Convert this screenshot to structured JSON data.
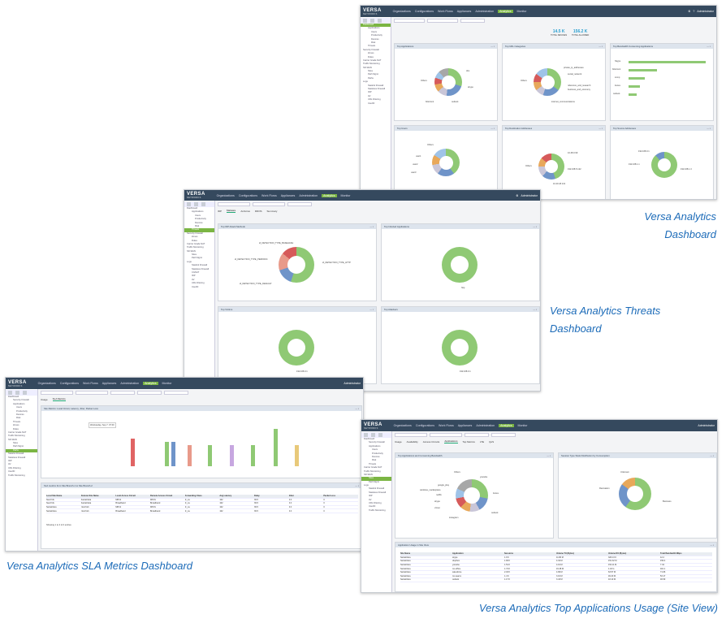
{
  "captions": {
    "dashboard_1": "Versa Analytics",
    "dashboard_2": "Dashboard",
    "threats_1": "Versa Analytics Threats",
    "threats_2": "Dashboard",
    "sla": "Versa Analytics SLA Metrics Dashboard",
    "apps": "Versa Analytics Top Applications Usage (Site View)"
  },
  "brand": {
    "logo": "VERSA",
    "sub": "NETWORKS"
  },
  "nav": [
    "Organizations",
    "Configurations",
    "Work Flows",
    "Appliances",
    "Administration",
    "Analytics",
    "Monitor"
  ],
  "user": "Administrator",
  "sidebar": {
    "items": [
      "Dashboard",
      "Applications",
      "Users",
      "Productivity",
      "Devices",
      "Risk",
      "Threats",
      "Security Firewall",
      "Zones",
      "Rules",
      "Carrier Grade NAT",
      "Traffic Monitoring",
      "SD-WAN",
      "Sites",
      "Path Mgmt",
      "Paths",
      "Logs",
      "Stateful Firewall",
      "Stateless Firewall",
      "CGNAT",
      "IDP",
      "AV",
      "URL Filtering",
      "UserID",
      "Traffic Monitoring",
      "Cgnat"
    ]
  },
  "dashboard": {
    "kpi": [
      {
        "label": "TOTAL DEVICES",
        "value": "14.5 K"
      },
      {
        "label": "TOTAL ALLOWED",
        "value": "156.2 K"
      }
    ],
    "panels": [
      "Top Applications",
      "Top URL Categories",
      "Top Bandwidth Consuming Applications",
      "Top Users",
      "Top Destination Addresses",
      "Top Source Addresses"
    ],
    "labels": {
      "apps": [
        "dns",
        "Others",
        "bittorrent",
        "snmp",
        "skype",
        "icloud",
        "itunes",
        "outlook"
      ],
      "url": [
        "private_ip_addresses",
        "social_network",
        "streaming_media",
        "reference_and_research",
        "business_and_economy",
        "internet_communications",
        "Others"
      ],
      "users": [
        "user1",
        "user2",
        "user3",
        "Others"
      ],
      "dest": [
        "Others",
        "10.48.0.99",
        "192.168.5.122",
        "10.40.18.131"
      ],
      "src": [
        "192.168.0.1",
        "192.168.1.1",
        "192.168.1.3"
      ]
    },
    "bar_labels": [
      "Skype",
      "bittorrent",
      "snmp",
      "itunes",
      "outlook"
    ]
  },
  "threats": {
    "tabs": [
      "IDP",
      "Malware",
      "Antivirus",
      "DDOS",
      "Summary"
    ],
    "panels": [
      "Top IDP Attack Methods",
      "Top Infected Applications",
      "Top Victims",
      "Top Attackers"
    ],
    "labels": [
      "id_DETECTION_TYPE_BASEHASH",
      "id_DETECTION_TYPE_HTTP",
      "id_DETECTION_TYPE_DEFAULT",
      "id_DETECTION_TYPE_PERIODIC"
    ],
    "infected": "http",
    "victim": "192.168.0.1",
    "attacker": "192.168.0.1"
  },
  "sla": {
    "tabs": [
      "Usage",
      "SLA Metrics"
    ],
    "panel": "Site Metrics: Local Circuit, Latency, Jitter, Packet Loss",
    "table_panel": "SLA metrics from Site Branch-1 to Site Branch-2",
    "columns": [
      "Local Site Name",
      "Remote Site Name",
      "Local Access Circuit",
      "Remote Access Circuit",
      "Forwarding Class",
      "Avg Latency",
      "Delay",
      "Jitter",
      "Packet Loss"
    ],
    "rows": [
      [
        "NewYork",
        "SantaClara",
        "MPLS",
        "MPLS",
        "fc_ca",
        "102",
        "39.5",
        "0.0",
        "0"
      ],
      [
        "NewYork",
        "SantaClara",
        "Broadband",
        "Broadband",
        "fc_ca",
        "102",
        "39.5",
        "0.0",
        "0"
      ],
      [
        "SantaClara",
        "NewYork",
        "MPLS",
        "MPLS",
        "fc_ca",
        "102",
        "39.5",
        "0.0",
        "0"
      ],
      [
        "SantaClara",
        "NewYork",
        "Broadband",
        "Broadband",
        "fc_ca",
        "102",
        "39.5",
        "0.0",
        "0"
      ]
    ],
    "tooltip": "Wednesday, Sep 7, 07:00",
    "footer": "Showing 1 to 4 of 4 entries"
  },
  "apps": {
    "tabs": [
      "Usage",
      "Availability",
      "Access Circuits",
      "Applications",
      "Top Metrics",
      "LTE",
      "QoS"
    ],
    "panels": [
      "Top Applications and Consuming Bandwidth",
      "Session Type Stats Distribution by Consumption"
    ],
    "labels": [
      "Others",
      "youtube",
      "google_play",
      "windows_marketplace",
      "netflix",
      "skype",
      "vimeo",
      "instagram",
      "itunes",
      "outlook"
    ],
    "right_labels": [
      "Unknown",
      "Business",
      "Recreation"
    ],
    "table_panel": "Application Usage in Site View",
    "columns": [
      "Site Name",
      "Application",
      "Sessions",
      "Volume TX (Bytes)",
      "Volume RX (Bytes)",
      "Total Bandwidth Mbps"
    ],
    "rows": [
      [
        "SantaClara",
        "skype",
        "1.9 K",
        "11.86 M",
        "326.13 K",
        "12.2"
      ],
      [
        "SantaClara",
        "dropbox",
        "1.83 K",
        "4.34 M",
        "151.32 M",
        "156.4"
      ],
      [
        "SantaClara",
        "youtube",
        "1.51 K",
        "4.19 M",
        "154.11 M",
        "7.34"
      ],
      [
        "SantaClara",
        "ms-office",
        "1.74 K",
        "19.48 M",
        "1.18 G",
        "401.1"
      ],
      [
        "SantaClara",
        "salesforce",
        "2.03 K",
        "4.99 M",
        "63.57 M",
        "71.66"
      ],
      [
        "SantaClara",
        "ms-teams",
        "1.4 K",
        "3.19 M",
        "49.20 M",
        "53.17"
      ],
      [
        "SantaClara",
        "outlook",
        "1.17 K",
        "3.43 M",
        "43.10 M",
        "46.59"
      ]
    ]
  }
}
